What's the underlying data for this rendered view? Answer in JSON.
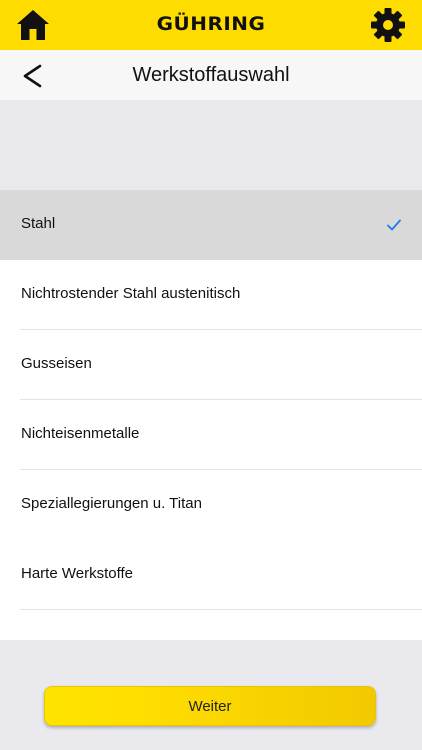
{
  "brand": {
    "logo_text": "GÜHRING",
    "color": "#ffdc00"
  },
  "icons": {
    "home": "home-icon",
    "settings": "gear-icon",
    "back": "chevron-left-icon",
    "check": "checkmark-icon"
  },
  "header": {
    "title": "Werkstoffauswahl"
  },
  "materials": {
    "items": [
      {
        "label": "Stahl",
        "selected": true
      },
      {
        "label": "Nichtrostender Stahl austenitisch",
        "selected": false
      },
      {
        "label": "Gusseisen",
        "selected": false
      },
      {
        "label": "Nichteisenmetalle",
        "selected": false
      },
      {
        "label": "Speziallegierungen u. Titan",
        "selected": false
      },
      {
        "label": "Harte Werkstoffe",
        "selected": false
      }
    ],
    "check_color": "#1a7cf0"
  },
  "footer": {
    "next_label": "Weiter"
  }
}
